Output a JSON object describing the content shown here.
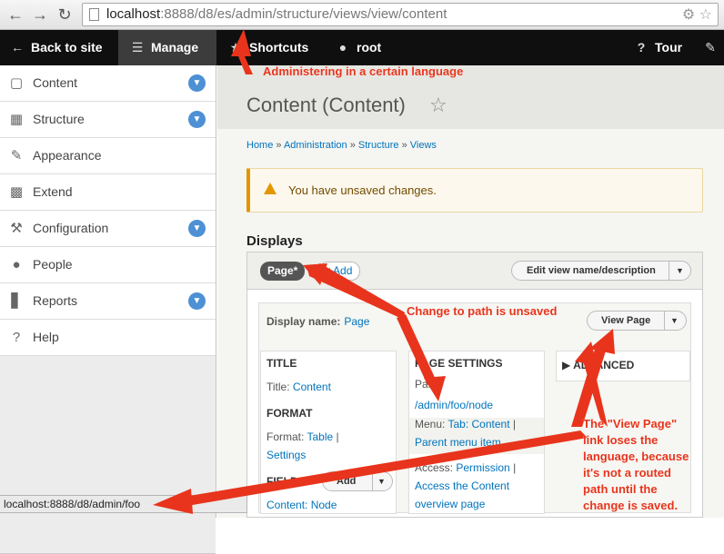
{
  "browser": {
    "url_host": "localhost",
    "url_rest": ":8888/d8/es/admin/structure/views/view/content",
    "status_url": "localhost:8888/d8/admin/foo"
  },
  "toolbar": {
    "back": "Back to site",
    "manage": "Manage",
    "shortcuts": "Shortcuts",
    "user": "root",
    "tour": "Tour"
  },
  "sidebar": {
    "items": [
      {
        "label": "Content",
        "icon": "content-icon",
        "expandable": true
      },
      {
        "label": "Structure",
        "icon": "structure-icon",
        "expandable": true
      },
      {
        "label": "Appearance",
        "icon": "appearance-icon",
        "expandable": false
      },
      {
        "label": "Extend",
        "icon": "extend-icon",
        "expandable": false
      },
      {
        "label": "Configuration",
        "icon": "configuration-icon",
        "expandable": true
      },
      {
        "label": "People",
        "icon": "people-icon",
        "expandable": false
      },
      {
        "label": "Reports",
        "icon": "reports-icon",
        "expandable": true
      },
      {
        "label": "Help",
        "icon": "help-icon",
        "expandable": false
      }
    ]
  },
  "page": {
    "title": "Content (Content)",
    "breadcrumb": [
      "Home",
      "Administration",
      "Structure",
      "Views"
    ],
    "message": "You have unsaved changes.",
    "displays_heading": "Displays",
    "tab_page": "Page*",
    "add_label": "Add",
    "edit_view_label": "Edit view name/description",
    "display_name_label": "Display name:",
    "display_name_value": "Page",
    "view_page_label": "View Page"
  },
  "columns": {
    "title_h": "TITLE",
    "title_label": "Title:",
    "title_value": "Content",
    "format_h": "FORMAT",
    "format_label": "Format:",
    "format_value": "Table",
    "format_sep": "|",
    "format_settings": "Settings",
    "fields_h": "FIELDS",
    "fields_add": "Add",
    "fields_item": "Content: Node",
    "page_settings_h": "PAGE SETTINGS",
    "path_label": "Path:",
    "path_value": "/admin/foo/node",
    "menu_label": "Menu:",
    "menu_value": "Tab: Content",
    "menu_sep": "|",
    "parent_menu": "Parent menu item",
    "access_label": "Access:",
    "access_value": "Permission",
    "access_sep": "|",
    "access_detail_1": "Access the Content",
    "access_detail_2": "overview page",
    "advanced_h": "ADVANCED"
  },
  "annotations": {
    "language": "Administering in a certain language",
    "path_unsaved": "Change to path is unsaved",
    "view_page_note": "The \"View Page\"\nlink loses the\nlanguage, because\nit's not a routed\npath until the\nchange is saved.",
    "color": "#e8341c"
  }
}
